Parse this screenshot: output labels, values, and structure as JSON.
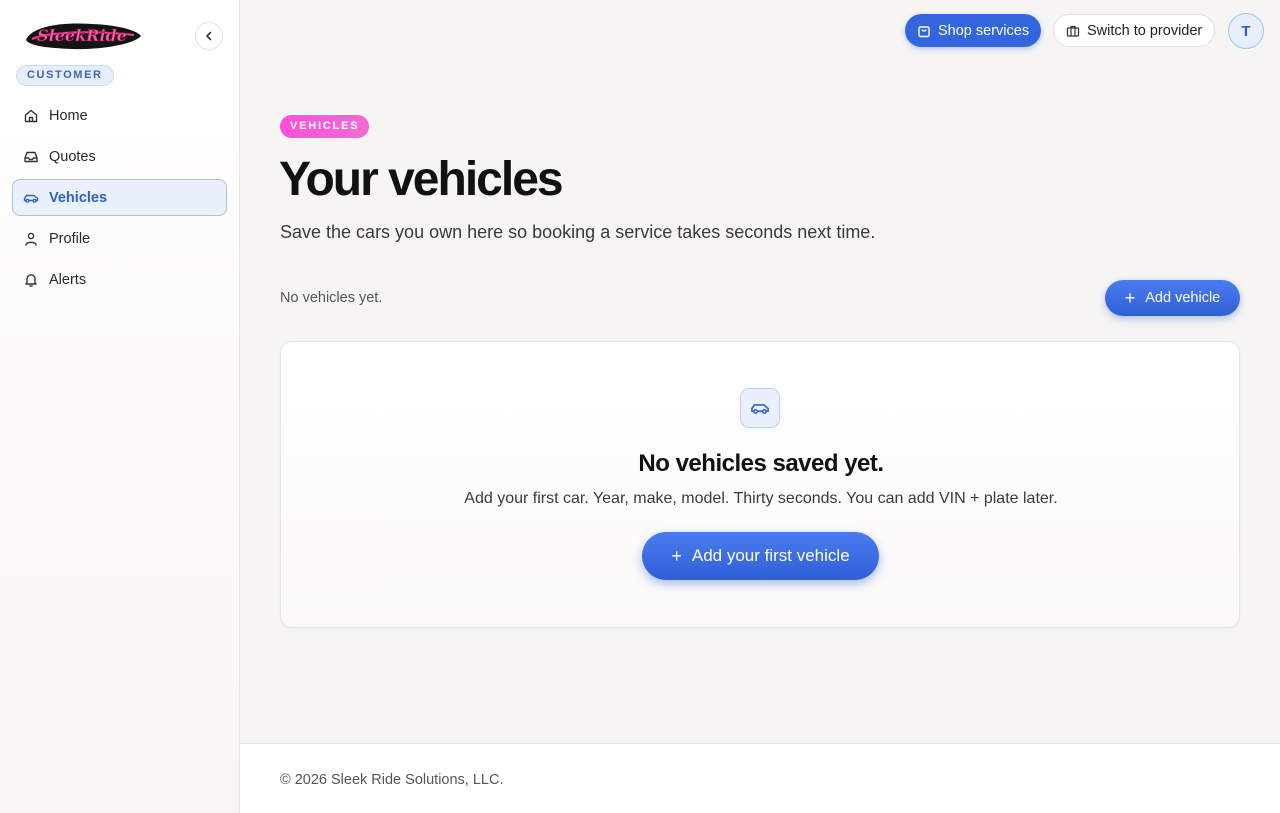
{
  "brand": {
    "logo_text": "SleekRide",
    "role": "CUSTOMER"
  },
  "sidebar": {
    "items": [
      {
        "label": "Home",
        "icon": "home-icon"
      },
      {
        "label": "Quotes",
        "icon": "inbox-icon"
      },
      {
        "label": "Vehicles",
        "icon": "car-icon",
        "active": true
      },
      {
        "label": "Profile",
        "icon": "user-icon"
      },
      {
        "label": "Alerts",
        "icon": "bell-icon"
      }
    ]
  },
  "topbar": {
    "shop_label": "Shop services",
    "switch_label": "Switch to provider",
    "avatar_initial": "T"
  },
  "main": {
    "eyebrow": "VEHICLES",
    "title": "Your vehicles",
    "subtitle": "Save the cars you own here so booking a service takes seconds next time.",
    "count_text": "No vehicles yet.",
    "add_label": "Add vehicle"
  },
  "empty_state": {
    "title": "No vehicles saved yet.",
    "description": "Add your first car. Year, make, model. Thirty seconds. You can add VIN + plate later.",
    "cta_label": "Add your first vehicle"
  },
  "footer": {
    "copyright": "© 2026 Sleek Ride Solutions, LLC."
  },
  "colors": {
    "accent": "#3366dd",
    "eyebrow": "#ff4fd8",
    "active_bg": "#eaf1fc"
  }
}
